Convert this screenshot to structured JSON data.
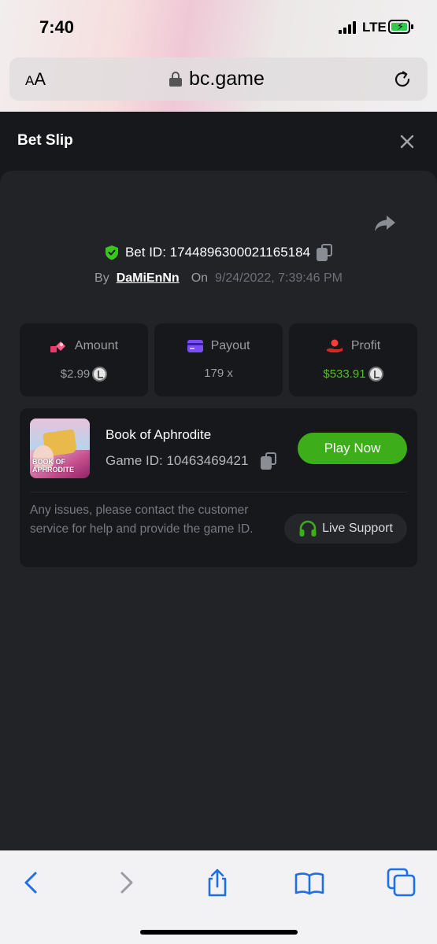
{
  "status_bar": {
    "time": "7:40",
    "network": "LTE"
  },
  "browser": {
    "aa_small": "A",
    "aa_big": "A",
    "url": "bc.game"
  },
  "bet_slip": {
    "title": "Bet Slip",
    "bet_id_label": "Bet ID: 1744896300021165184",
    "by_label": "By",
    "username": "DaMiEnNn",
    "on_label": "On",
    "date": "9/24/2022, 7:39:46 PM"
  },
  "stats": {
    "amount": {
      "label": "Amount",
      "value": "$2.99"
    },
    "payout": {
      "label": "Payout",
      "value": "179 x"
    },
    "profit": {
      "label": "Profit",
      "value": "$533.91"
    }
  },
  "game": {
    "name": "Book of Aphrodite",
    "thumb_line1": "BOOK OF",
    "thumb_line2": "APHRODITE",
    "game_id_label": "Game ID: 10463469421",
    "play_label": "Play Now",
    "help_text": "Any issues, please contact the customer service for help and provide the game ID.",
    "support_label": "Live Support"
  },
  "colors": {
    "page_bg": "#17181b",
    "card_bg": "#222327",
    "accent_green": "#3dae19",
    "profit_green": "#4cc31c",
    "ios_blue": "#1f6fe5"
  },
  "icons": [
    "aa-icon",
    "lock-icon",
    "reload-icon",
    "close-icon",
    "share-icon",
    "shield-icon",
    "copy-icon",
    "amount-icon",
    "payout-icon",
    "profit-icon",
    "coin-icon",
    "headset-icon",
    "back-icon",
    "forward-icon",
    "share-sheet-icon",
    "bookmarks-icon",
    "tabs-icon"
  ]
}
